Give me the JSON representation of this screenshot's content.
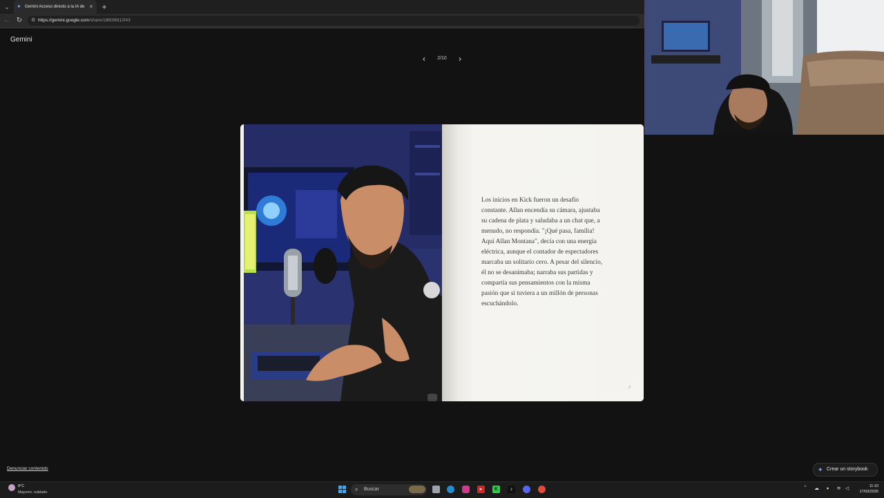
{
  "browser": {
    "tab_title": "Gemini Acceso directo a la IA de Google",
    "tab_close": "×",
    "new_tab": "+",
    "url_host": "https://gemini.google.com",
    "url_path": "/share/18609fd12f43"
  },
  "page": {
    "brand": "Gemini",
    "pagination": {
      "current": "2/10",
      "prev_icon": "‹",
      "next_icon": "›"
    },
    "story_text": "Los inicios en Kick fueron un desafío constante. Allan encendía su cámara, ajustaba su cadena de plata y saludaba a un chat que, a menudo, no respondía. \"¡Qué pasa, familia! Aquí Allan Montana\", decía con una energía eléctrica, aunque el contador de espectadores marcaba un solitario cero. A pesar del silencio, él no se desanimaba; narraba sus partidas y compartía sus pensamientos con la misma pasión que si tuviera a un millón de personas escuchándolo.",
    "page_number": "2",
    "report_link": "Denunciar contenido",
    "create_button": "Crear un storybook"
  },
  "taskbar": {
    "temperature": "8°C",
    "weather": "Mayorm. nublado",
    "search_placeholder": "Buscar",
    "time": "11:10",
    "date": "17/03/2026",
    "apps": [
      "file-explorer-icon",
      "edge-icon",
      "instagram-icon",
      "youtube-icon",
      "kick-icon",
      "tiktok-icon",
      "discord-icon",
      "chrome-icon"
    ]
  },
  "colors": {
    "page_bg": "#121212",
    "book_paper": "#f4f3f0",
    "text": "#3a3a3a",
    "accent": "#7fb0ff"
  }
}
